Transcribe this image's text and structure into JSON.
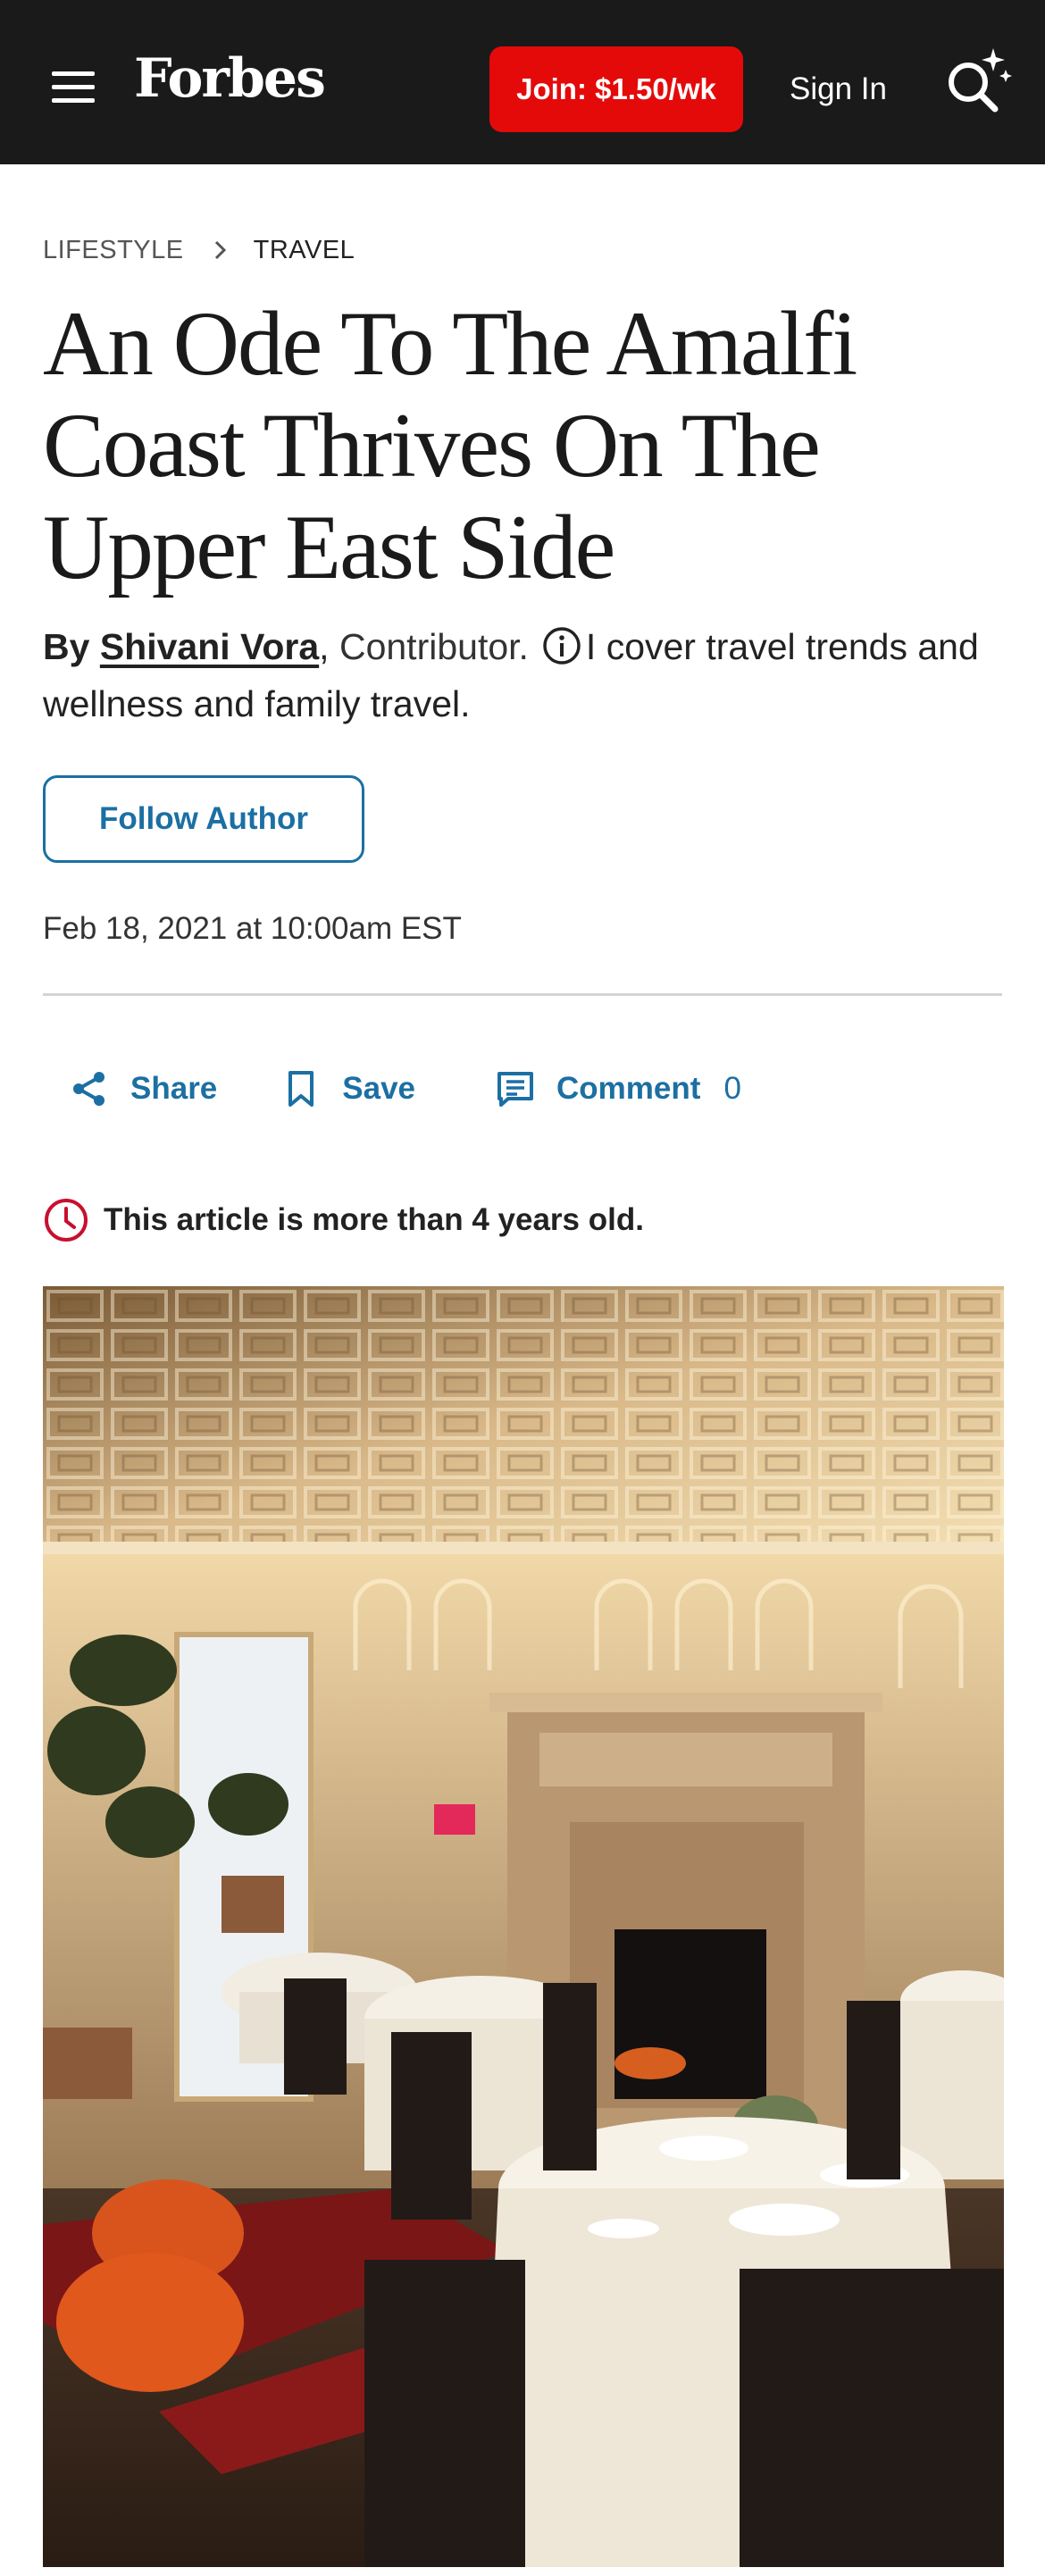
{
  "header": {
    "brand": "Forbes",
    "join_label": "Join: $1.50/wk",
    "signin_label": "Sign In",
    "menu_icon": "hamburger-menu-icon",
    "search_icon": "search-sparkle-icon",
    "bg_color": "#1a1a1a",
    "join_color": "#e40a0a"
  },
  "breadcrumb": {
    "items": [
      "LIFESTYLE",
      "TRAVEL"
    ],
    "separator_icon": "chevron-right-icon"
  },
  "article": {
    "headline": "An Ode To The Amalfi Coast Thrives On The Upper East Side",
    "byline_prefix": "By",
    "author": "Shivani Vora",
    "author_comma": ",",
    "author_role": "Contributor.",
    "author_bio": "I cover travel trends and wellness and family travel.",
    "follow_label": "Follow Author",
    "date": "Feb 18, 2021 at 10:00am EST",
    "accent_color": "#1c6fa3"
  },
  "actions": {
    "share_label": "Share",
    "save_label": "Save",
    "comment_label": "Comment",
    "comment_count": "0"
  },
  "notice": {
    "text": "This article is more than 4 years old.",
    "icon": "clock-icon",
    "icon_color": "#c8102e"
  },
  "hero_image": {
    "subject": "restaurant-dining-room-photo"
  }
}
